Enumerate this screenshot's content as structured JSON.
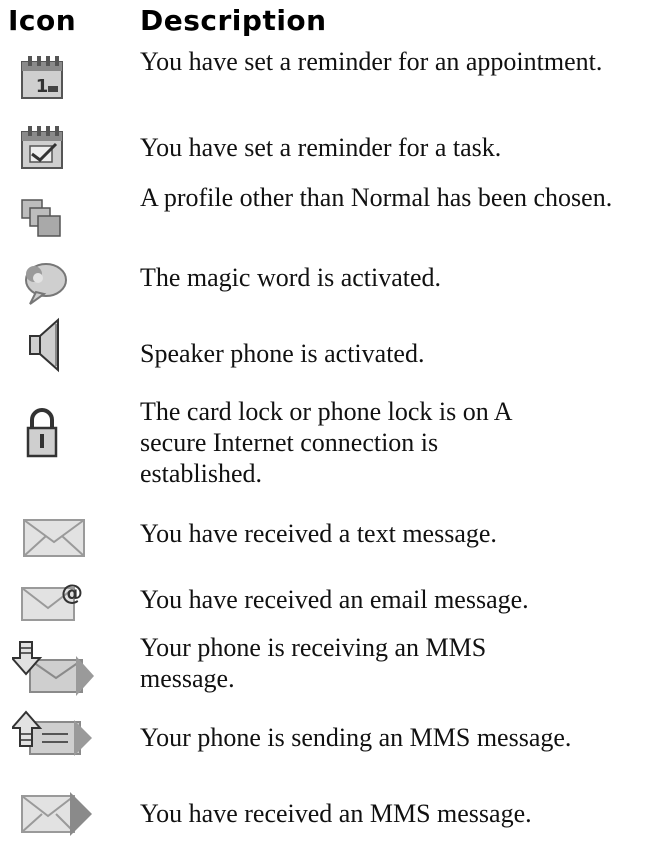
{
  "header": {
    "icon_label": "Icon",
    "description_label": "Description"
  },
  "rows": [
    {
      "icon": "appointment-reminder-icon",
      "description": "You have set a reminder for an appointment."
    },
    {
      "icon": "task-reminder-icon",
      "description": "You have set a reminder for a task."
    },
    {
      "icon": "profile-icon",
      "description": "A profile other than Normal has been chosen."
    },
    {
      "icon": "magic-word-icon",
      "description": "The magic word is activated."
    },
    {
      "icon": "speaker-phone-icon",
      "description": "Speaker phone is activated."
    },
    {
      "icon": "lock-icon",
      "description": "The card lock or phone lock is on A secure Internet connection is established."
    },
    {
      "icon": "text-message-icon",
      "description": "You have received a text message."
    },
    {
      "icon": "email-message-icon",
      "description": "You have received an email message."
    },
    {
      "icon": "mms-receiving-icon",
      "description": "Your phone is receiving an MMS message."
    },
    {
      "icon": "mms-sending-icon",
      "description": "Your phone is sending an MMS message."
    },
    {
      "icon": "mms-received-icon",
      "description": "You have received an MMS message."
    }
  ],
  "colors": {
    "icon_fill": "#c9c9c9",
    "icon_stroke": "#555555",
    "icon_dark": "#3a3a3a"
  }
}
